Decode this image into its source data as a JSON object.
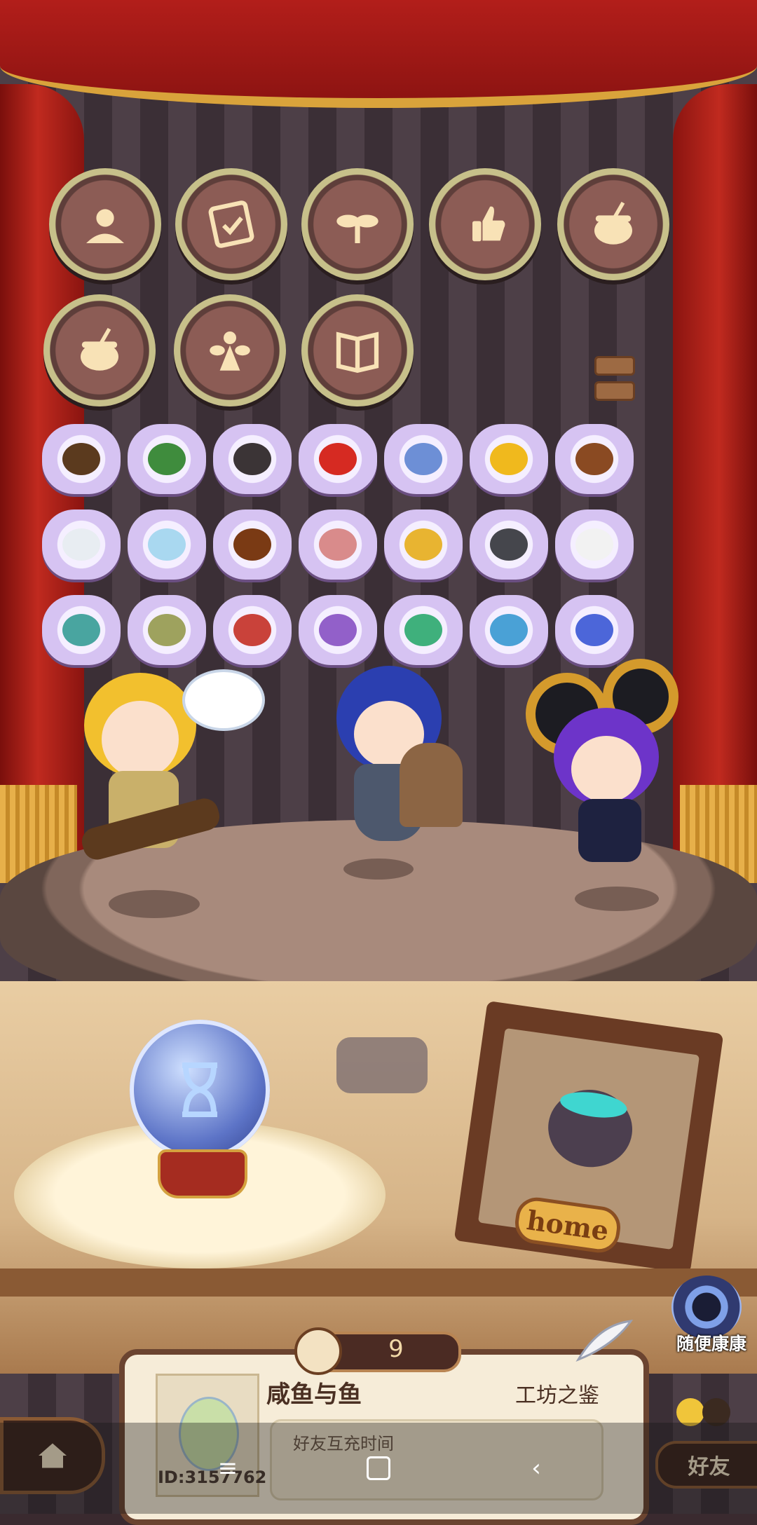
{
  "stage": {
    "badges_row1": [
      "sun-leaf-badge",
      "certificate-badge",
      "sprout-badge",
      "thumbs-up-badge",
      "cauldron-badge"
    ],
    "badges_row2": [
      "cauldron-badge",
      "fairy-badge",
      "book-badge"
    ],
    "items": [
      [
        "#5b3a1e",
        "#3f8c3d",
        "#3b3436",
        "#d62a22",
        "#6d8fd6",
        "#f0b91d",
        "#8a4a22"
      ],
      [
        "#e8edf2",
        "#a9d8f0",
        "#7a3a14",
        "#d98b8b",
        "#e8b431",
        "#45464c",
        "#f2f2f2"
      ],
      [
        "#49a5a0",
        "#9ea25e",
        "#c9423a",
        "#9260c9",
        "#3fb07c",
        "#4aa1d6",
        "#4c66d9"
      ]
    ]
  },
  "orb": {
    "icon": "hourglass-icon"
  },
  "home_frame": {
    "label": "home"
  },
  "vortex": {
    "label": "随便康康"
  },
  "player_card": {
    "likes": "9",
    "name": "咸鱼与鱼",
    "title": "工坊之鉴",
    "friend_recharge_label": "好友互充时间",
    "id": "ID:3157762"
  },
  "buttons": {
    "friends": "好友"
  },
  "colors": {
    "curtain": "#b21e1a",
    "fringe": "#d9a33b",
    "card": "#f6ecd8"
  }
}
